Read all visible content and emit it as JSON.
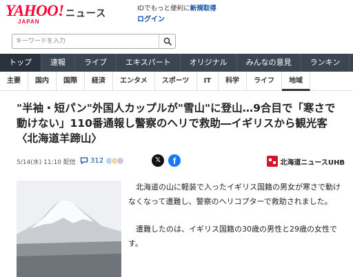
{
  "header": {
    "logo_main": "YAHOO!",
    "logo_sub": "JAPAN",
    "service": "ニュース",
    "login_message": "IDでもっと便利に",
    "register_link": "新規取得",
    "login_link": "ログイン"
  },
  "search": {
    "placeholder": "キーワードを入力",
    "icon": "search-icon"
  },
  "main_nav": [
    "トップ",
    "速報",
    "ライブ",
    "エキスパート",
    "オリジナル",
    "みんなの意見",
    "ランキン"
  ],
  "sub_nav": [
    "主要",
    "国内",
    "国際",
    "経済",
    "エンタメ",
    "スポーツ",
    "IT",
    "科学",
    "ライフ",
    "地域"
  ],
  "article": {
    "headline": "\"半袖・短パン\"外国人カップルが\"雪山\"に登山…9合目で「寒さで動けない」110番通報し警察のヘリで救助―イギリスから観光客〈北海道羊蹄山〉",
    "date": "5/14(水) 11:10 配信",
    "comment_count": "312",
    "source": "北海道ニュースUHB",
    "paragraphs": [
      "北海道の山に軽装で入ったイギリス国籍の男女が寒さで動けなくなって遭難し、警察のヘリコプターで救助されました。",
      "遭難したのは、イギリス国籍の30歳の男性と29歳の女性です。"
    ]
  },
  "colors": {
    "brand": "#ff0033",
    "nav_bg": "#3c4653",
    "link": "#0b4fa0",
    "source_badge": "#d7152a"
  }
}
